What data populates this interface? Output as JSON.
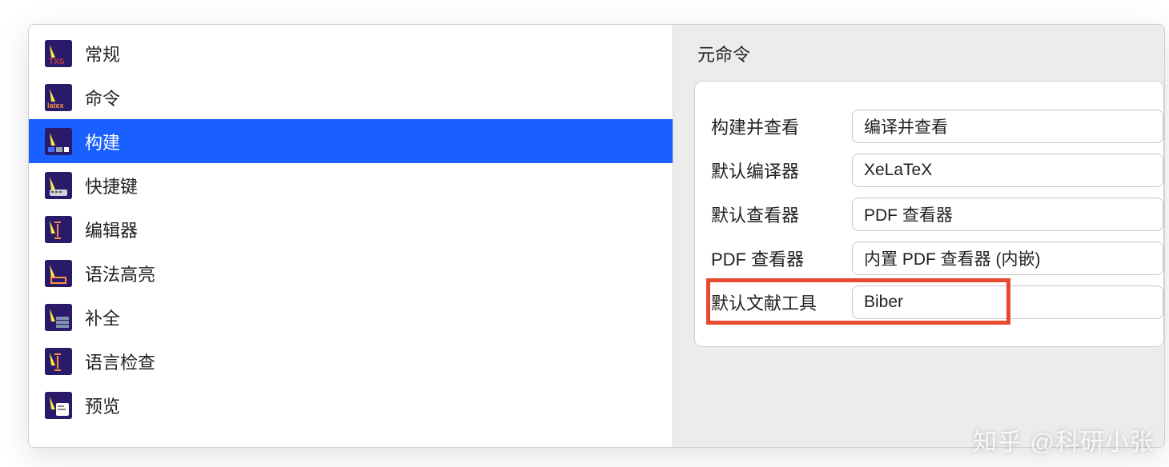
{
  "sidebar": {
    "items": [
      {
        "label": "常规",
        "icon": "txs"
      },
      {
        "label": "命令",
        "icon": "latex"
      },
      {
        "label": "构建",
        "icon": "build",
        "selected": true
      },
      {
        "label": "快捷键",
        "icon": "keyboard"
      },
      {
        "label": "编辑器",
        "icon": "editor"
      },
      {
        "label": "语法高亮",
        "icon": "highlight"
      },
      {
        "label": "补全",
        "icon": "complete"
      },
      {
        "label": "语言检查",
        "icon": "language"
      },
      {
        "label": "预览",
        "icon": "preview"
      }
    ]
  },
  "section": {
    "title": "元命令",
    "rows": [
      {
        "label": "构建并查看",
        "value": "编译并查看"
      },
      {
        "label": "默认编译器",
        "value": "XeLaTeX"
      },
      {
        "label": "默认查看器",
        "value": "PDF 查看器"
      },
      {
        "label": "PDF 查看器",
        "value": "内置 PDF 查看器 (内嵌)"
      },
      {
        "label": "默认文献工具",
        "value": "Biber",
        "highlighted": true
      }
    ]
  },
  "watermark": "知乎 @科研小张"
}
